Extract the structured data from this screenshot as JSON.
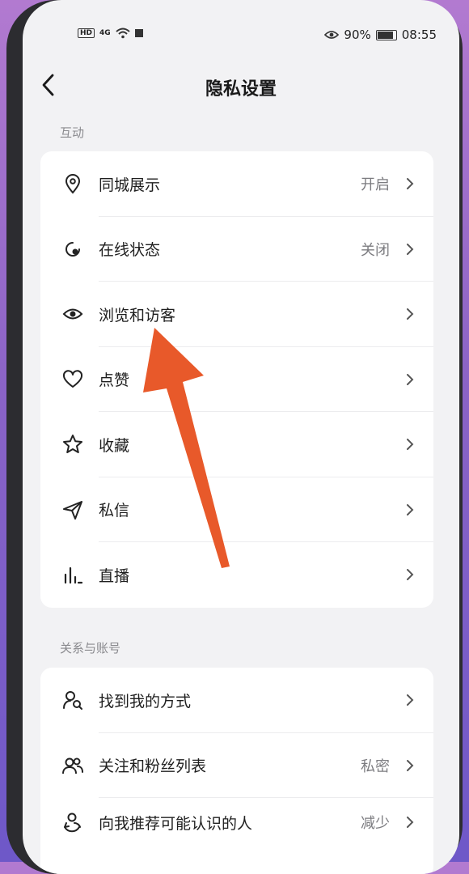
{
  "status_bar": {
    "network": "HD",
    "signal_label": "4G",
    "battery": "90%",
    "time": "08:55"
  },
  "header": {
    "title": "隐私设置"
  },
  "sections": [
    {
      "title": "互动",
      "items": [
        {
          "label": "同城展示",
          "value": "开启",
          "icon": "location-pin-icon"
        },
        {
          "label": "在线状态",
          "value": "关闭",
          "icon": "online-status-icon"
        },
        {
          "label": "浏览和访客",
          "value": "",
          "icon": "eye-icon"
        },
        {
          "label": "点赞",
          "value": "",
          "icon": "heart-icon"
        },
        {
          "label": "收藏",
          "value": "",
          "icon": "star-icon"
        },
        {
          "label": "私信",
          "value": "",
          "icon": "paper-plane-icon"
        },
        {
          "label": "直播",
          "value": "",
          "icon": "bar-chart-icon"
        }
      ]
    },
    {
      "title": "关系与账号",
      "items": [
        {
          "label": "找到我的方式",
          "value": "",
          "icon": "user-search-icon"
        },
        {
          "label": "关注和粉丝列表",
          "value": "私密",
          "icon": "users-icon"
        },
        {
          "label": "向我推荐可能认识的人",
          "value": "减少",
          "icon": "recommend-people-icon"
        }
      ]
    }
  ],
  "colors": {
    "annotation_arrow": "#e8592a",
    "background_gradient_top": "#b27ad0",
    "background_gradient_bottom": "#6e58c8"
  }
}
